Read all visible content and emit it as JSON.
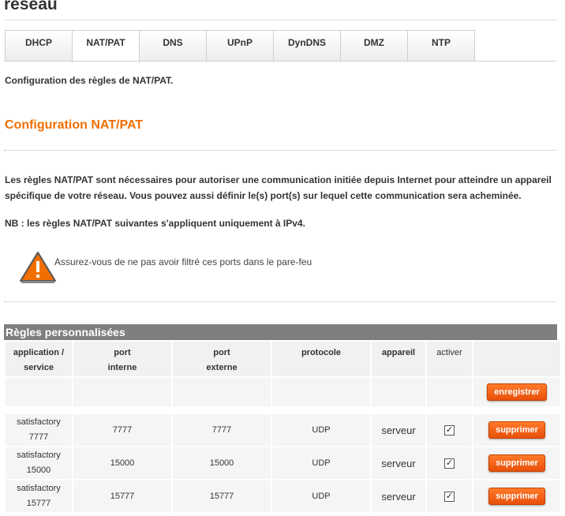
{
  "page": {
    "title": "réseau",
    "intro": "Configuration des règles de NAT/PAT."
  },
  "tabs": [
    {
      "label": "DHCP",
      "active": false
    },
    {
      "label": "NAT/PAT",
      "active": true
    },
    {
      "label": "DNS",
      "active": false
    },
    {
      "label": "UPnP",
      "active": false
    },
    {
      "label": "DynDNS",
      "active": false
    },
    {
      "label": "DMZ",
      "active": false
    },
    {
      "label": "NTP",
      "active": false
    }
  ],
  "section": {
    "title": "Configuration NAT/PAT",
    "desc_line1": "Les règles NAT/PAT sont nécessaires pour autoriser une communication initiée depuis Internet pour atteindre un appareil",
    "desc_line2": "spécifique de votre réseau. Vous pouvez aussi définir le(s) port(s) sur lequel cette communication sera acheminée.",
    "nb": "NB : les règles NAT/PAT suivantes s'appliquent uniquement à IPv4.",
    "warning": "Assurez-vous de ne pas avoir filtré ces ports dans le pare-feu"
  },
  "rules": {
    "header": "Règles personnalisées",
    "columns": {
      "application_1": "application /",
      "application_2": "service",
      "internal_1": "port",
      "internal_2": "interne",
      "external_1": "port",
      "external_2": "externe",
      "protocol": "protocole",
      "device": "appareil",
      "enable": "activer"
    },
    "save_label": "enregistrer",
    "delete_label": "supprimer",
    "rows": [
      {
        "app_1": "satisfactory 7777",
        "app_2": "",
        "internal": "7777",
        "external": "7777",
        "protocol": "UDP",
        "device": "serveur",
        "enabled": "✓"
      },
      {
        "app_1": "satisfactory",
        "app_2": "15000",
        "internal": "15000",
        "external": "15000",
        "protocol": "UDP",
        "device": "serveur",
        "enabled": "✓"
      },
      {
        "app_1": "satisfactory",
        "app_2": "15777",
        "internal": "15777",
        "external": "15777",
        "protocol": "UDP",
        "device": "serveur",
        "enabled": "✓"
      }
    ]
  },
  "colors": {
    "accent": "#f16e00",
    "header_gray": "#7f7f7f",
    "button_orange": "#ff6600"
  }
}
